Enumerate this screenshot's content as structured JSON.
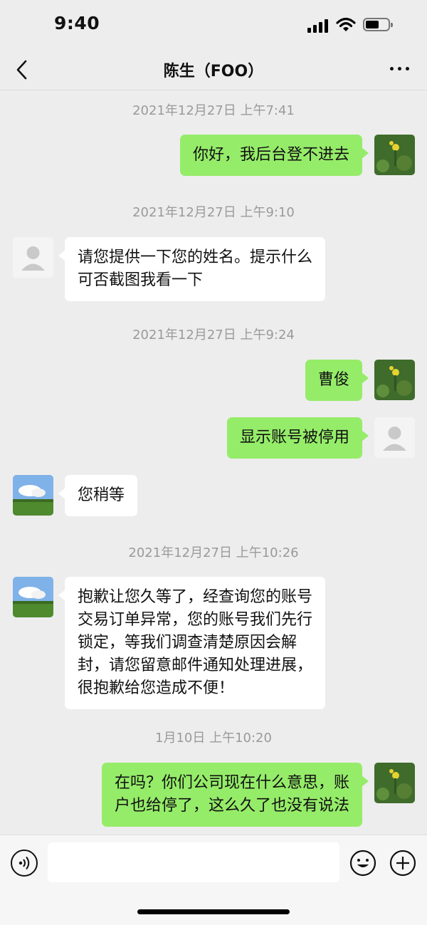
{
  "status": {
    "time": "9:40"
  },
  "nav": {
    "title": "陈生（FOO）"
  },
  "messages": [
    {
      "timestamp": "2021年12月27日 上午7:41",
      "text": "你好，我后台登不进去",
      "from": "me"
    },
    {
      "timestamp": "2021年12月27日 上午9:10",
      "text": "请您提供一下您的姓名。提示什么\n可否截图我看一下",
      "from": "other"
    },
    {
      "timestamp": "2021年12月27日 上午9:24",
      "text": "曹俊",
      "from": "me"
    },
    {
      "text": "显示账号被停用",
      "from": "me"
    },
    {
      "text": "您稍等",
      "from": "other"
    },
    {
      "timestamp": "2021年12月27日 上午10:26",
      "text": "抱歉让您久等了，经查询您的账号\n交易订单异常，您的账号我们先行\n锁定，等我们调查清楚原因会解\n封，请您留意邮件通知处理进展，\n很抱歉给您造成不便！",
      "from": "other"
    },
    {
      "timestamp": "1月10日 上午10:20",
      "text": "在吗？你们公司现在什么意思，账\n户也给停了，这么久了也没有说法",
      "from": "me"
    }
  ],
  "colors": {
    "background": "#ededed",
    "outgoing_bubble": "#95ec69",
    "incoming_bubble": "#ffffff",
    "timestamp": "#9a9a9a"
  },
  "icons": [
    "back-chevron-icon",
    "more-dots-icon",
    "voice-icon",
    "emoji-icon",
    "plus-icon",
    "signal-icon",
    "wifi-icon",
    "battery-icon"
  ]
}
